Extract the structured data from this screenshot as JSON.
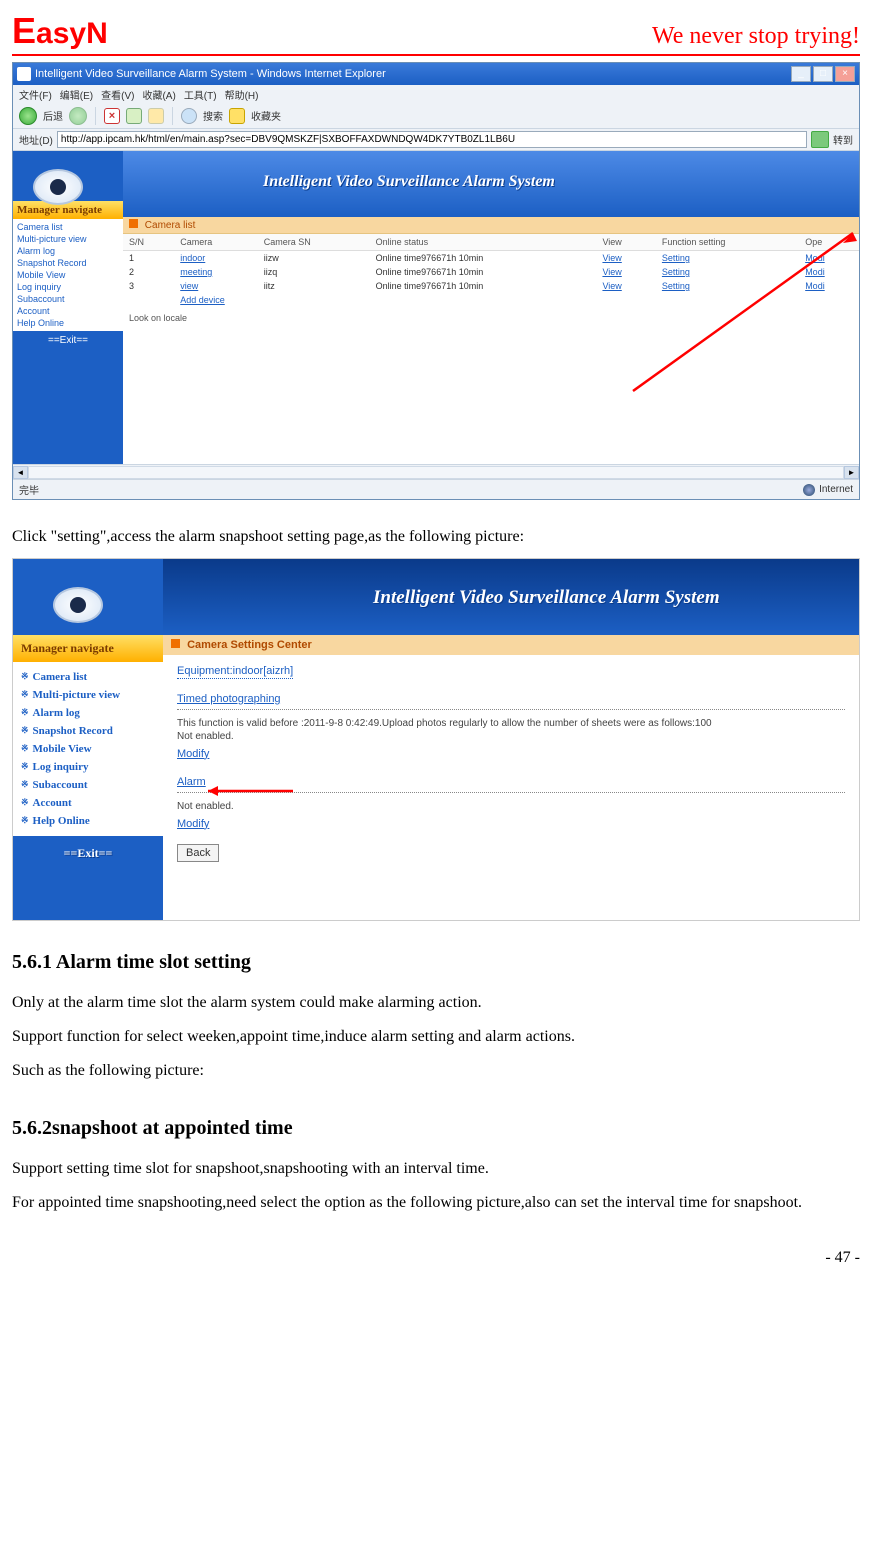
{
  "header": {
    "logo_E": "E",
    "logo_rest": "asy",
    "logo_N": "N",
    "tagline": "We never stop trying!"
  },
  "ie": {
    "title": "Intelligent Video Surveillance Alarm System - Windows Internet Explorer",
    "menu": [
      "文件(F)",
      "编辑(E)",
      "查看(V)",
      "收藏(A)",
      "工具(T)",
      "帮助(H)"
    ],
    "back_label": "后退",
    "search_label": "搜索",
    "fav_label": "收藏夹",
    "addr_label": "地址(D)",
    "addr_url": "http://app.ipcam.hk/html/en/main.asp?sec=DBV9QMSKZF|SXBOFFAXDWNDQW4DK7YTB0ZL1LB6U",
    "go_label": "转到",
    "banner_title": "Intelligent Video Surveillance Alarm System",
    "nav_head": "Manager navigate",
    "nav_items": [
      "Camera list",
      "Multi-picture view",
      "Alarm log",
      "Snapshot Record",
      "Mobile View",
      "Log inquiry",
      "Subaccount",
      "Account",
      "Help Online"
    ],
    "exit": "==Exit==",
    "camera_list_head": "Camera list",
    "columns": [
      "S/N",
      "Camera",
      "Camera SN",
      "Online status",
      "View",
      "Function setting",
      "Ope"
    ],
    "rows": [
      {
        "sn": "1",
        "cam": "indoor",
        "csn": "iizw",
        "status": "Online time976671h 10min",
        "view": "View",
        "setting": "Setting",
        "ope": "Modi"
      },
      {
        "sn": "2",
        "cam": "meeting",
        "csn": "iizq",
        "status": "Online time976671h 10min",
        "view": "View",
        "setting": "Setting",
        "ope": "Modi"
      },
      {
        "sn": "3",
        "cam": "view",
        "csn": "iitz",
        "status": "Online time976671h 10min",
        "view": "View",
        "setting": "Setting",
        "ope": "Modi"
      }
    ],
    "add_device": "Add device",
    "look_locale": "Look on locale",
    "status_done": "完毕",
    "status_zone": "Internet"
  },
  "body1": "Click \"setting\",access the alarm snapshoot setting page,as the following picture:",
  "shot2": {
    "banner_title": "Intelligent Video Surveillance Alarm System",
    "nav_head": "Manager navigate",
    "nav_items": [
      "Camera list",
      "Multi-picture view",
      "Alarm log",
      "Snapshot Record",
      "Mobile View",
      "Log inquiry",
      "Subaccount",
      "Account",
      "Help Online"
    ],
    "exit": "==Exit==",
    "csc_head": "Camera Settings Center",
    "equipment": "Equipment:indoor[aizrh]",
    "timed_title": "Timed photographing",
    "timed_text": "This function is valid before :2011-9-8 0:42:49.Upload photos regularly to allow the number of sheets were as follows:100",
    "not_enabled1": "Not enabled.",
    "modify1": "Modify",
    "alarm_title": "Alarm",
    "not_enabled2": "Not enabled.",
    "modify2": "Modify",
    "back": "Back"
  },
  "h561": "5.6.1 Alarm time slot setting",
  "p561a": "Only at the alarm time slot the alarm system could make alarming action.",
  "p561b": "Support function for select weeken,appoint time,induce alarm setting and alarm actions.",
  "p561c": "Such as the following picture:",
  "h562": "5.6.2snapshoot at appointed time",
  "p562a": "Support setting time slot for snapshoot,snapshooting with an interval time.",
  "p562b": "For appointed time snapshooting,need select the option as the following picture,also can set the interval time for snapshoot.",
  "page_num": "- 47 -"
}
